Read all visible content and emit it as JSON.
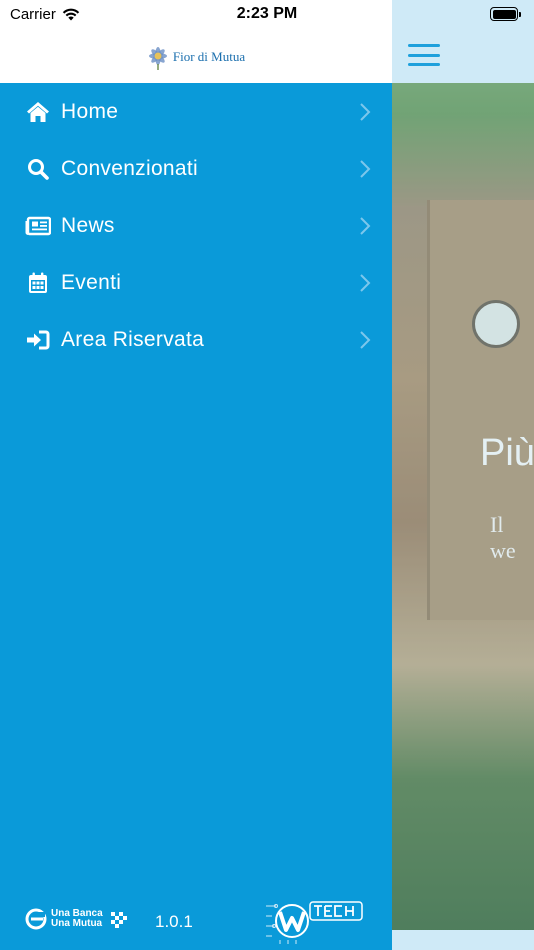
{
  "status_bar": {
    "carrier": "Carrier",
    "time": "2:23 PM"
  },
  "header": {
    "logo_text": "Fior di Mutua"
  },
  "menu": {
    "items": [
      {
        "label": "Home",
        "icon": "home-icon"
      },
      {
        "label": "Convenzionati",
        "icon": "search-icon"
      },
      {
        "label": "News",
        "icon": "newspaper-icon"
      },
      {
        "label": "Eventi",
        "icon": "calendar-icon"
      },
      {
        "label": "Area Riservata",
        "icon": "sign-in-icon"
      }
    ]
  },
  "footer": {
    "brand_line1": "Una Banca",
    "brand_line2": "Una Mutua",
    "version": "1.0.1",
    "partner_logo": "wtech-logo"
  },
  "background": {
    "title_partial": "Più",
    "subtitle_partial": "Il we"
  },
  "colors": {
    "drawer": "#0a9ad9",
    "accent": "#1ea0dc",
    "header_bg": "#ffffff"
  }
}
